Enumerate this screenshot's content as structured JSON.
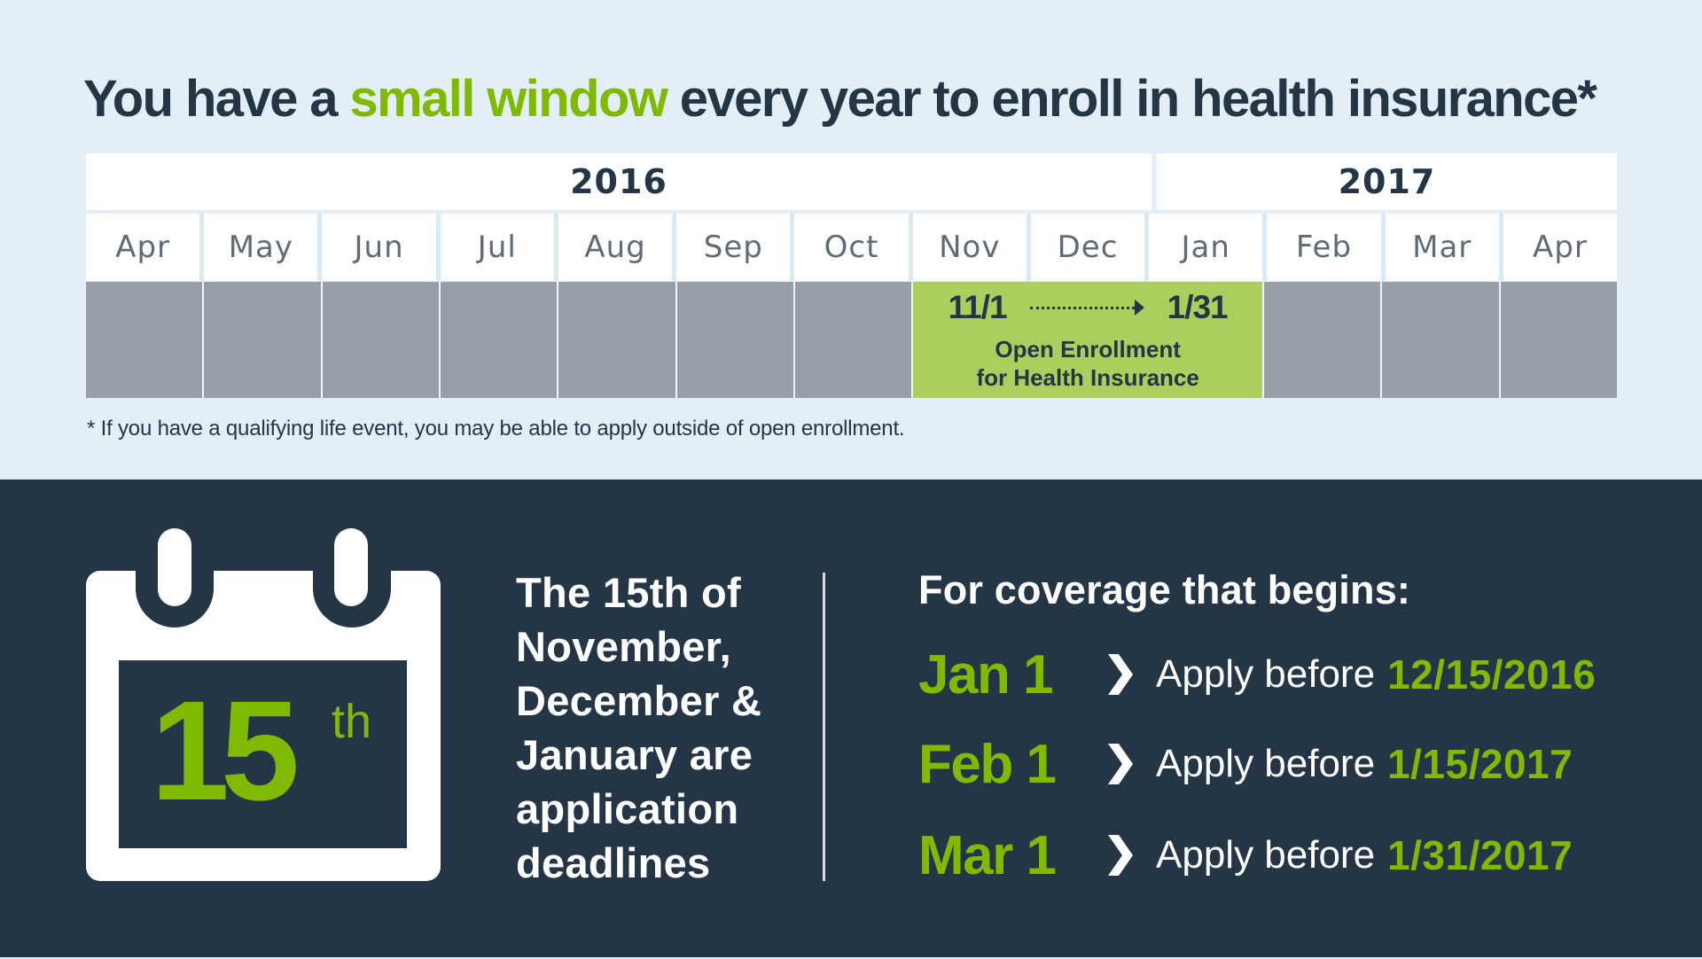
{
  "headline": {
    "before": "You have a ",
    "accent": "small window",
    "after": " every year to enroll in health insurance*"
  },
  "timeline": {
    "years": [
      "2016",
      "2017"
    ],
    "months": [
      "Apr",
      "May",
      "Jun",
      "Jul",
      "Aug",
      "Sep",
      "Oct",
      "Nov",
      "Dec",
      "Jan",
      "Feb",
      "Mar",
      "Apr"
    ],
    "enrollment": {
      "start": "11/1",
      "end": "1/31",
      "label_line1": "Open Enrollment",
      "label_line2": "for Health Insurance",
      "start_month": "Nov",
      "end_month": "Jan"
    }
  },
  "footnote": "* If you have a qualifying life event, you may be able to apply outside of open enrollment.",
  "calendar": {
    "number": "15",
    "suffix": "th"
  },
  "deadline_text": {
    "lines": [
      "The 15th of",
      "November,",
      "December &",
      "January are",
      "application",
      "deadlines"
    ]
  },
  "coverage": {
    "title": "For coverage that begins:",
    "rows": [
      {
        "month": "Jan 1",
        "label": "Apply before",
        "date": "12/15/2016"
      },
      {
        "month": "Feb 1",
        "label": "Apply before",
        "date": "1/15/2017"
      },
      {
        "month": "Mar 1",
        "label": "Apply before",
        "date": "1/31/2017"
      }
    ]
  },
  "colors": {
    "navy": "#243646",
    "green_accent": "#7fba00",
    "enroll_green": "#abcf5c",
    "gray_bar": "#97a0a9",
    "light_bg": "#e3eef8"
  }
}
